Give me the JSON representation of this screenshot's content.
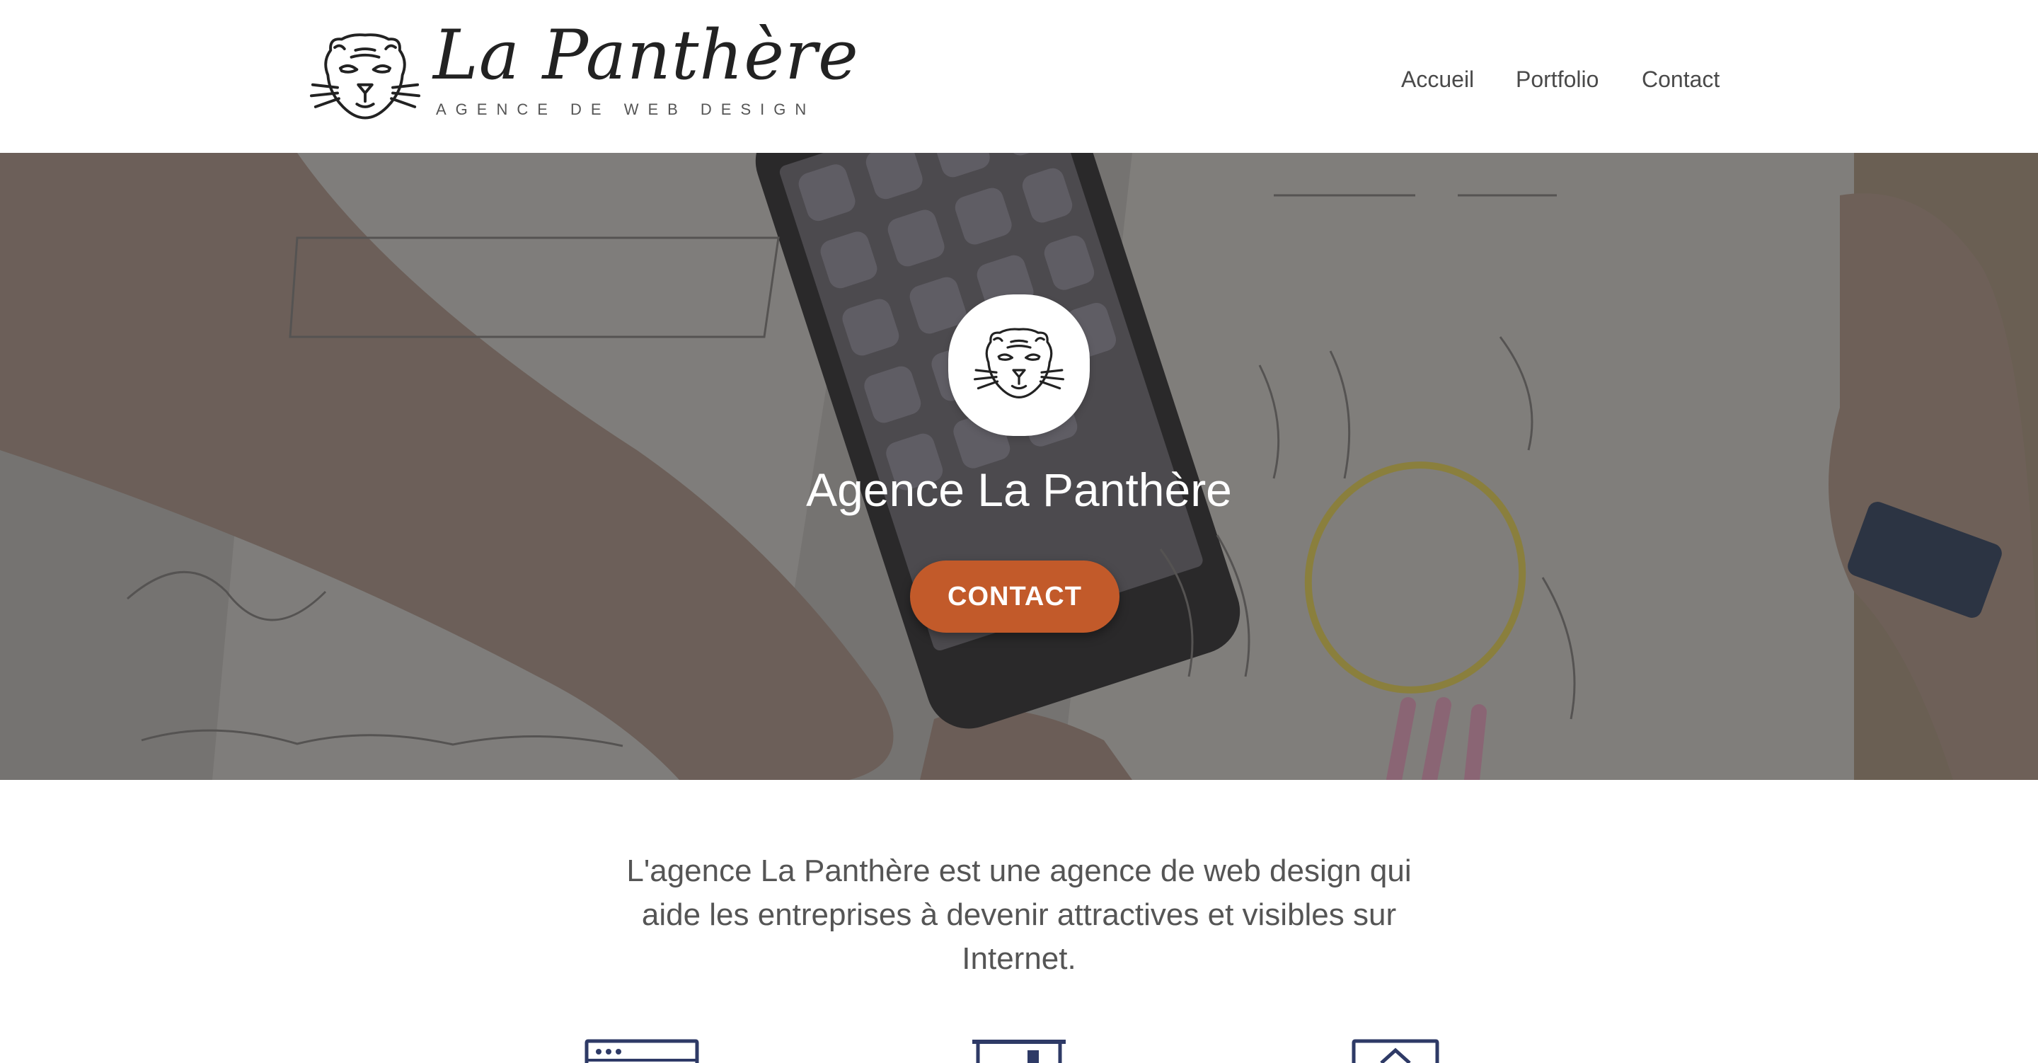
{
  "header": {
    "logo_title": "La Panthère",
    "logo_subtitle": "AGENCE DE WEB DESIGN",
    "logo_icon": "panther-head-icon",
    "nav": [
      {
        "label": "Accueil"
      },
      {
        "label": "Portfolio"
      },
      {
        "label": "Contact"
      }
    ]
  },
  "hero": {
    "badge_icon": "panther-head-icon",
    "title": "Agence La Panthère",
    "button_label": "CONTACT",
    "button_color": "#c25a2a"
  },
  "intro": {
    "text": "L'agence La Panthère est une agence de web design qui aide les entreprises à devenir attractives et visibles sur Internet."
  },
  "features": {
    "icons": [
      "browser-window-icon",
      "presentation-board-icon",
      "house-frame-icon"
    ]
  },
  "colors": {
    "accent": "#c25a2a",
    "icon_navy": "#2e3a66",
    "text": "#4a4a4a"
  }
}
